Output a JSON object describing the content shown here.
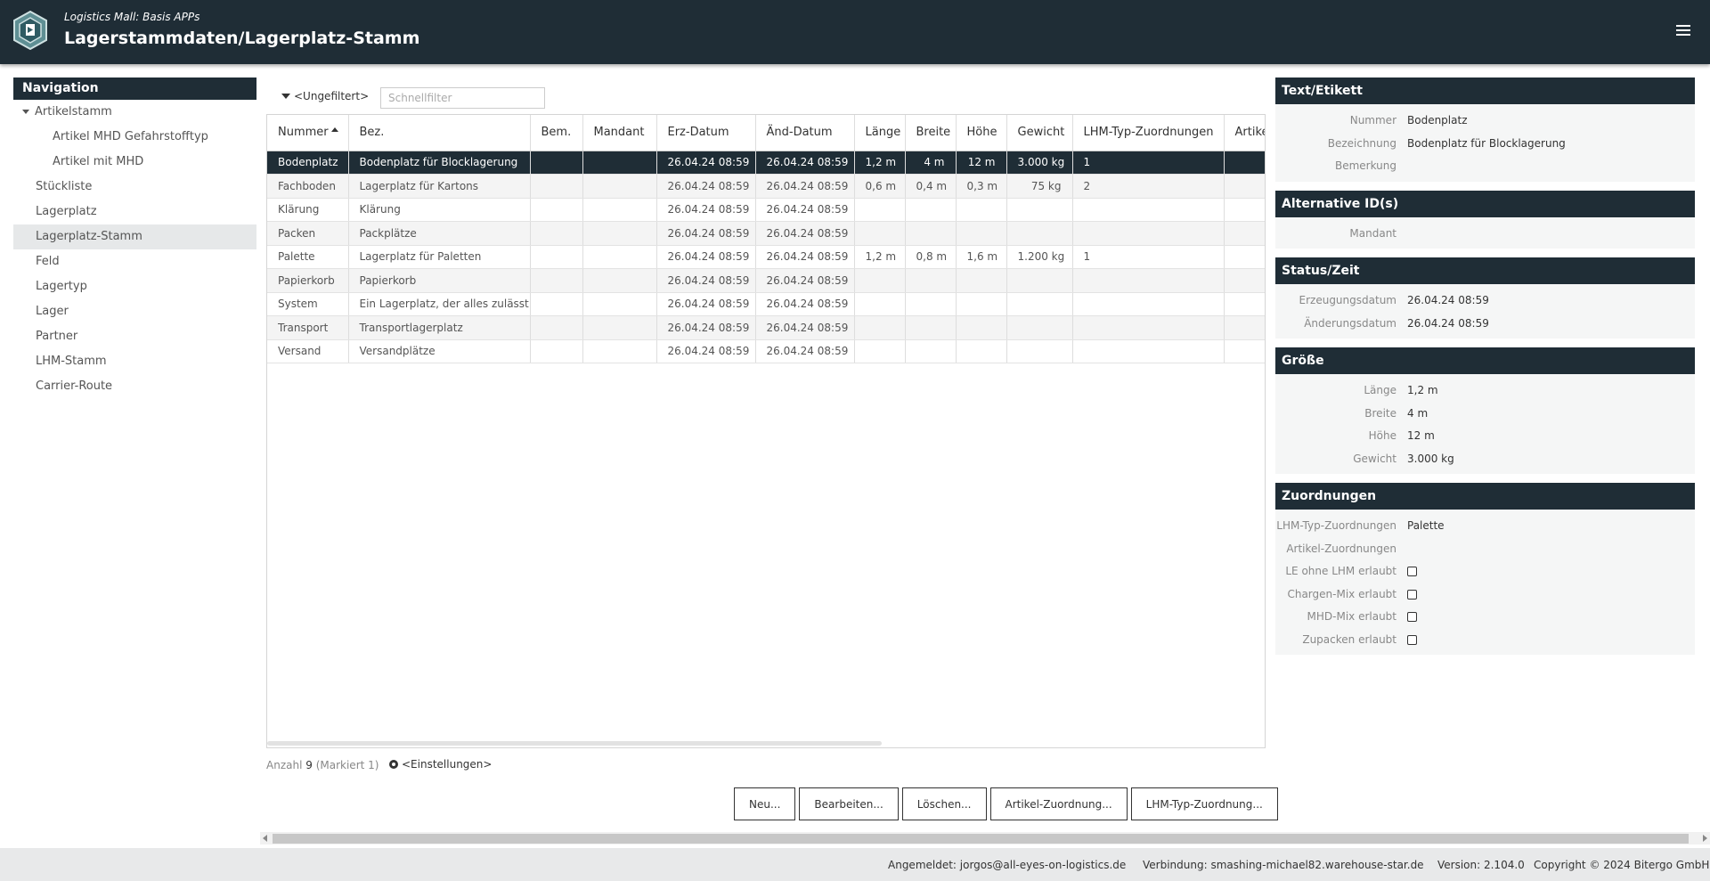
{
  "header": {
    "subtitle": "Logistics Mall: Basis APPs",
    "title": "Lagerstammdaten/Lagerplatz-Stamm"
  },
  "navigation": {
    "title": "Navigation",
    "items": [
      {
        "label": "Artikelstamm",
        "level": 0,
        "expanded": true
      },
      {
        "label": "Artikel MHD Gefahrstofftyp",
        "level": 1
      },
      {
        "label": "Artikel mit MHD",
        "level": 1
      },
      {
        "label": "Stückliste",
        "level": 0
      },
      {
        "label": "Lagerplatz",
        "level": 0
      },
      {
        "label": "Lagerplatz-Stamm",
        "level": 0,
        "active": true
      },
      {
        "label": "Feld",
        "level": 0
      },
      {
        "label": "Lagertyp",
        "level": 0
      },
      {
        "label": "Lager",
        "level": 0
      },
      {
        "label": "Partner",
        "level": 0
      },
      {
        "label": "LHM-Stamm",
        "level": 0
      },
      {
        "label": "Carrier-Route",
        "level": 0
      }
    ]
  },
  "filter": {
    "toggle_label": "<Ungefiltert>",
    "quick_placeholder": "Schnellfilter"
  },
  "table": {
    "columns": [
      "Nummer",
      "Bez.",
      "Bem.",
      "Mandant",
      "Erz-Datum",
      "Änd-Datum",
      "Länge",
      "Breite",
      "Höhe",
      "Gewicht",
      "LHM-Typ-Zuordnungen",
      "Artikel-Zuordnungen"
    ],
    "sorted_column": "Nummer",
    "sort_direction": "ascending",
    "rows": [
      [
        "Bodenplatz",
        "Bodenplatz für Blocklagerung",
        "",
        "",
        "26.04.24 08:59",
        "26.04.24 08:59",
        "1,2 m",
        "4 m",
        "12 m",
        "3.000 kg",
        "1",
        ""
      ],
      [
        "Fachboden",
        "Lagerplatz für Kartons",
        "",
        "",
        "26.04.24 08:59",
        "26.04.24 08:59",
        "0,6 m",
        "0,4 m",
        "0,3 m",
        "75 kg",
        "2",
        ""
      ],
      [
        "Klärung",
        "Klärung",
        "",
        "",
        "26.04.24 08:59",
        "26.04.24 08:59",
        "",
        "",
        "",
        "",
        "",
        ""
      ],
      [
        "Packen",
        "Packplätze",
        "",
        "",
        "26.04.24 08:59",
        "26.04.24 08:59",
        "",
        "",
        "",
        "",
        "",
        ""
      ],
      [
        "Palette",
        "Lagerplatz für Paletten",
        "",
        "",
        "26.04.24 08:59",
        "26.04.24 08:59",
        "1,2 m",
        "0,8 m",
        "1,6 m",
        "1.200 kg",
        "1",
        ""
      ],
      [
        "Papierkorb",
        "Papierkorb",
        "",
        "",
        "26.04.24 08:59",
        "26.04.24 08:59",
        "",
        "",
        "",
        "",
        "",
        ""
      ],
      [
        "System",
        "Ein Lagerplatz, der alles zulässt",
        "",
        "",
        "26.04.24 08:59",
        "26.04.24 08:59",
        "",
        "",
        "",
        "",
        "",
        ""
      ],
      [
        "Transport",
        "Transportlagerplatz",
        "",
        "",
        "26.04.24 08:59",
        "26.04.24 08:59",
        "",
        "",
        "",
        "",
        "",
        ""
      ],
      [
        "Versand",
        "Versandplätze",
        "",
        "",
        "26.04.24 08:59",
        "26.04.24 08:59",
        "",
        "",
        "",
        "",
        "",
        ""
      ]
    ],
    "selected_row": 0
  },
  "status": {
    "count_label": "Anzahl",
    "count": "9",
    "marked": "(Markiert 1)",
    "settings_label": "<Einstellungen>"
  },
  "buttons": {
    "new": "Neu...",
    "edit": "Bearbeiten...",
    "delete": "Löschen...",
    "article_assign": "Artikel-Zuordnung...",
    "lhm_assign": "LHM-Typ-Zuordnung..."
  },
  "footer": {
    "logged_in": "Angemeldet: jorgos@all-eyes-on-logistics.de",
    "connection": "Verbindung: smashing-michael82.warehouse-star.de",
    "version": "Version: 2.104.0",
    "copyright": "Copyright © 2024 Bitergo GmbH"
  },
  "detail": {
    "text": {
      "title": "Text/Etikett",
      "fields": [
        {
          "label": "Nummer",
          "value": "Bodenplatz"
        },
        {
          "label": "Bezeichnung",
          "value": "Bodenplatz für Blocklagerung"
        },
        {
          "label": "Bemerkung",
          "value": ""
        }
      ]
    },
    "alt_ids": {
      "title": "Alternative ID(s)",
      "fields": [
        {
          "label": "Mandant",
          "value": ""
        }
      ]
    },
    "status_time": {
      "title": "Status/Zeit",
      "fields": [
        {
          "label": "Erzeugungsdatum",
          "value": "26.04.24 08:59"
        },
        {
          "label": "Änderungsdatum",
          "value": "26.04.24 08:59"
        }
      ]
    },
    "size": {
      "title": "Größe",
      "fields": [
        {
          "label": "Länge",
          "value": "1,2 m"
        },
        {
          "label": "Breite",
          "value": "4 m"
        },
        {
          "label": "Höhe",
          "value": "12 m"
        },
        {
          "label": "Gewicht",
          "value": "3.000 kg"
        }
      ]
    },
    "assignments": {
      "title": "Zuordnungen",
      "fields": [
        {
          "label": "LHM-Typ-Zuordnungen",
          "value": "Palette"
        },
        {
          "label": "Artikel-Zuordnungen",
          "value": ""
        }
      ],
      "checkboxes": [
        {
          "label": "LE ohne LHM erlaubt",
          "checked": false
        },
        {
          "label": "Chargen-Mix erlaubt",
          "checked": false
        },
        {
          "label": "MHD-Mix erlaubt",
          "checked": false
        },
        {
          "label": "Zupacken erlaubt",
          "checked": false
        }
      ]
    }
  }
}
